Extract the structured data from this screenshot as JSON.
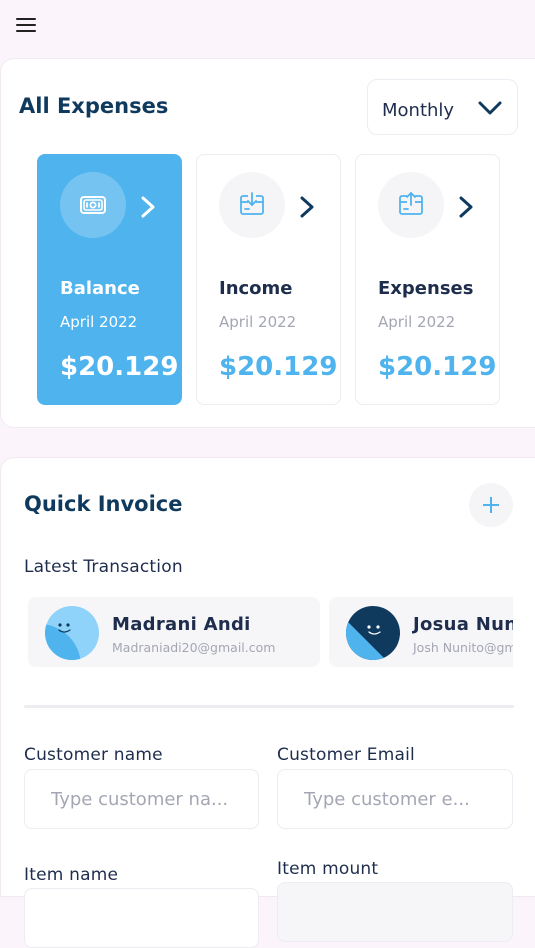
{
  "header": {
    "menu_icon": "hamburger-menu-icon"
  },
  "expenses": {
    "title": "All Expenses",
    "period": "Monthly",
    "cards": [
      {
        "name": "Balance",
        "date": "April 2022",
        "amount": "$20.129",
        "icon": "wallet-icon",
        "active": true
      },
      {
        "name": "Income",
        "date": "April 2022",
        "amount": "$20.129",
        "icon": "card-download-icon",
        "active": false
      },
      {
        "name": "Expenses",
        "date": "April 2022",
        "amount": "$20.129",
        "icon": "card-upload-icon",
        "active": false
      }
    ]
  },
  "invoice": {
    "title": "Quick Invoice",
    "latest_label": "Latest Transaction",
    "transactions": [
      {
        "name": "Madrani Andi",
        "email": "Madraniadi20@gmail.com"
      },
      {
        "name": "Josua Nunito",
        "email": "Josh Nunito@gmail.com"
      }
    ],
    "form": {
      "customer_name_label": "Customer name",
      "customer_name_placeholder": "Type customer na...",
      "customer_email_label": "Customer Email",
      "customer_email_placeholder": "Type customer e...",
      "item_name_label": "Item name",
      "item_amount_label": "Item mount"
    }
  },
  "colors": {
    "accent": "#4fb3ee",
    "title": "#0f3a5e",
    "muted": "#a4a7b3"
  }
}
